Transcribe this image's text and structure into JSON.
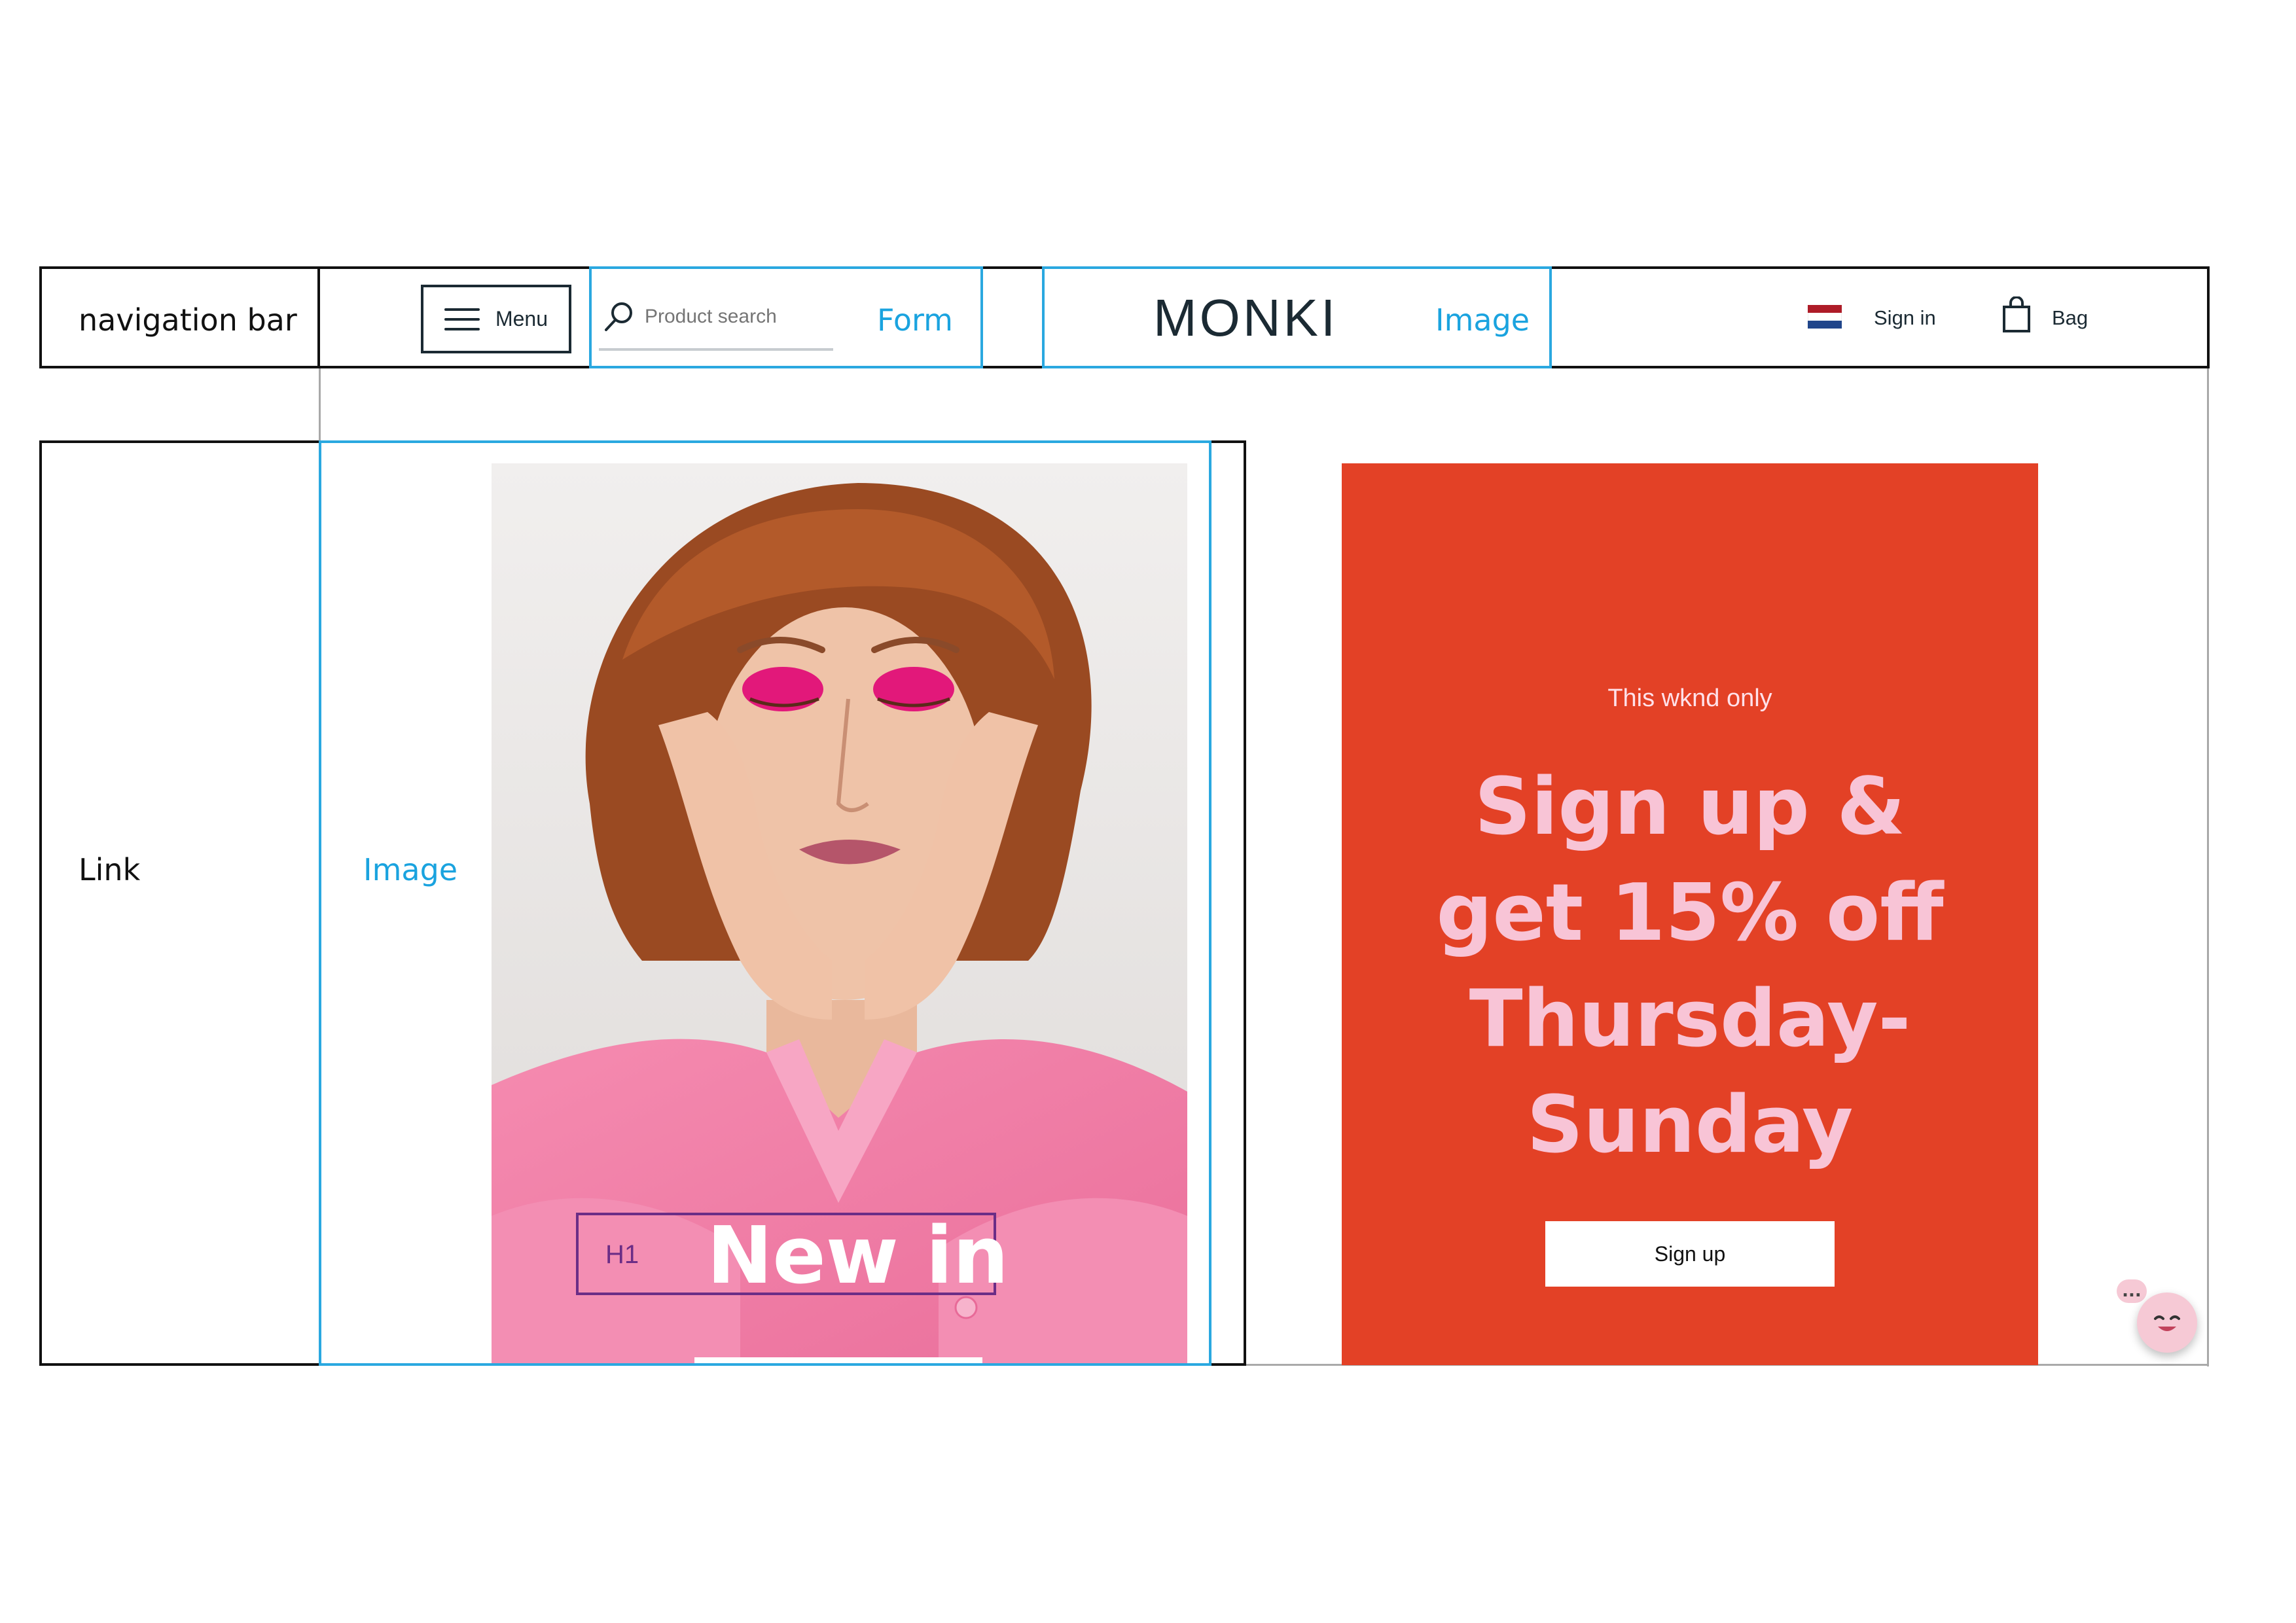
{
  "annotations": {
    "navigation_bar": "navigation bar",
    "form": "Form",
    "image_logo": "Image",
    "link": "Link",
    "image_hero": "Image",
    "h1": "H1"
  },
  "nav": {
    "menu_label": "Menu",
    "search_placeholder": "Product search",
    "logo_text": "MONKI",
    "sign_in": "Sign in",
    "bag": "Bag"
  },
  "hero": {
    "headline": "New in"
  },
  "promo": {
    "kicker": "This wknd only",
    "headline": "Sign up & get 15% off Thursday-Sunday",
    "button": "Sign up"
  },
  "chat": {
    "dots": "..."
  },
  "colors": {
    "annotation_blue": "#2aa8e0",
    "annotation_purple": "#6b2d86",
    "promo_red": "#e34126",
    "promo_pink_text": "#f8c4d6",
    "navy": "#1b2a33"
  },
  "icons": [
    "hamburger-icon",
    "search-icon",
    "netherlands-flag-icon",
    "shopping-bag-icon",
    "chat-bot-icon"
  ]
}
